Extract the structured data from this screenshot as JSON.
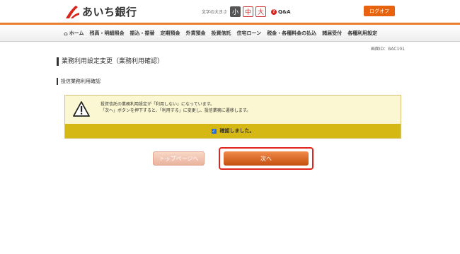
{
  "header": {
    "bank_name": "あいち銀行",
    "font_size_label": "文字の大きさ",
    "font_sizes": [
      "小",
      "中",
      "大"
    ],
    "faq_label": "Q&A",
    "logout_label": "ログオフ",
    "brand_color": "#d9231b",
    "accent_color": "#e87c2a"
  },
  "nav": {
    "items": [
      "ホーム",
      "残高・明細照会",
      "振込・振替",
      "定期預金",
      "外貨預金",
      "投資信託",
      "住宅ローン",
      "税金・各種料金の払込",
      "諸届受付",
      "各種利用設定"
    ]
  },
  "screen_id": "画面ID：BAC101",
  "page_title": "業務利用設定変更（業務利用確認）",
  "section_title": "投信業務利用確認",
  "notice": {
    "line1": "投資信託の業務利用設定が「利用しない」になっています。",
    "line2": "「次へ」ボタンを押下すると、「利用する」に変更し、投信業務に遷移します。",
    "confirm_label": "確認しました。",
    "confirmed": true
  },
  "buttons": {
    "top_page": "トップページへ",
    "next": "次へ"
  }
}
